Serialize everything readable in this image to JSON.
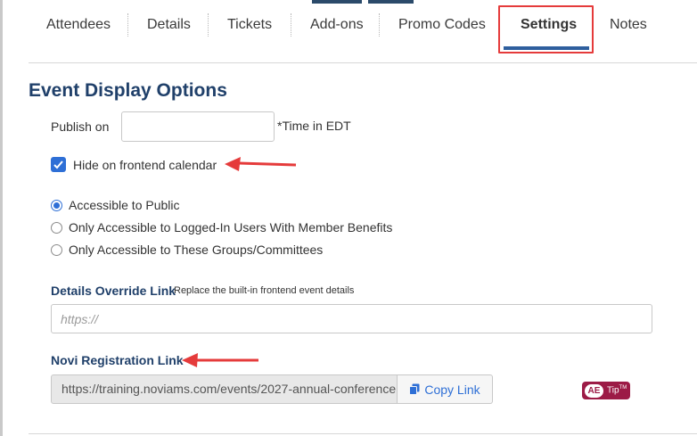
{
  "tabs": [
    {
      "label": "Attendees"
    },
    {
      "label": "Details"
    },
    {
      "label": "Tickets"
    },
    {
      "label": "Add-ons"
    },
    {
      "label": "Promo Codes"
    },
    {
      "label": "Settings",
      "active": true
    },
    {
      "label": "Notes"
    }
  ],
  "section": {
    "title": "Event Display Options"
  },
  "publish": {
    "label": "Publish on",
    "value": "",
    "note": "*Time in EDT"
  },
  "hide_calendar": {
    "label": "Hide on frontend calendar",
    "checked": true
  },
  "access": {
    "options": [
      {
        "label": "Accessible to Public",
        "selected": true
      },
      {
        "label": "Only Accessible to Logged-In Users With Member Benefits",
        "selected": false
      },
      {
        "label": "Only Accessible to These Groups/Committees",
        "selected": false
      }
    ]
  },
  "details_override": {
    "label": "Details Override Link",
    "hint": "Replace the built-in frontend event details",
    "placeholder": "https://"
  },
  "registration": {
    "label": "Novi Registration Link",
    "value": "https://training.noviams.com/events/2027-annual-conference",
    "copy_label": "Copy Link"
  },
  "ae_tip": {
    "badge": "AE",
    "text": "Tip",
    "mark": "TM"
  },
  "colors": {
    "accent": "#2e6fd6",
    "heading": "#20406a",
    "highlight": "#e53b3b",
    "arrow": "#e53b3b",
    "ae_badge": "#9c1b46"
  }
}
